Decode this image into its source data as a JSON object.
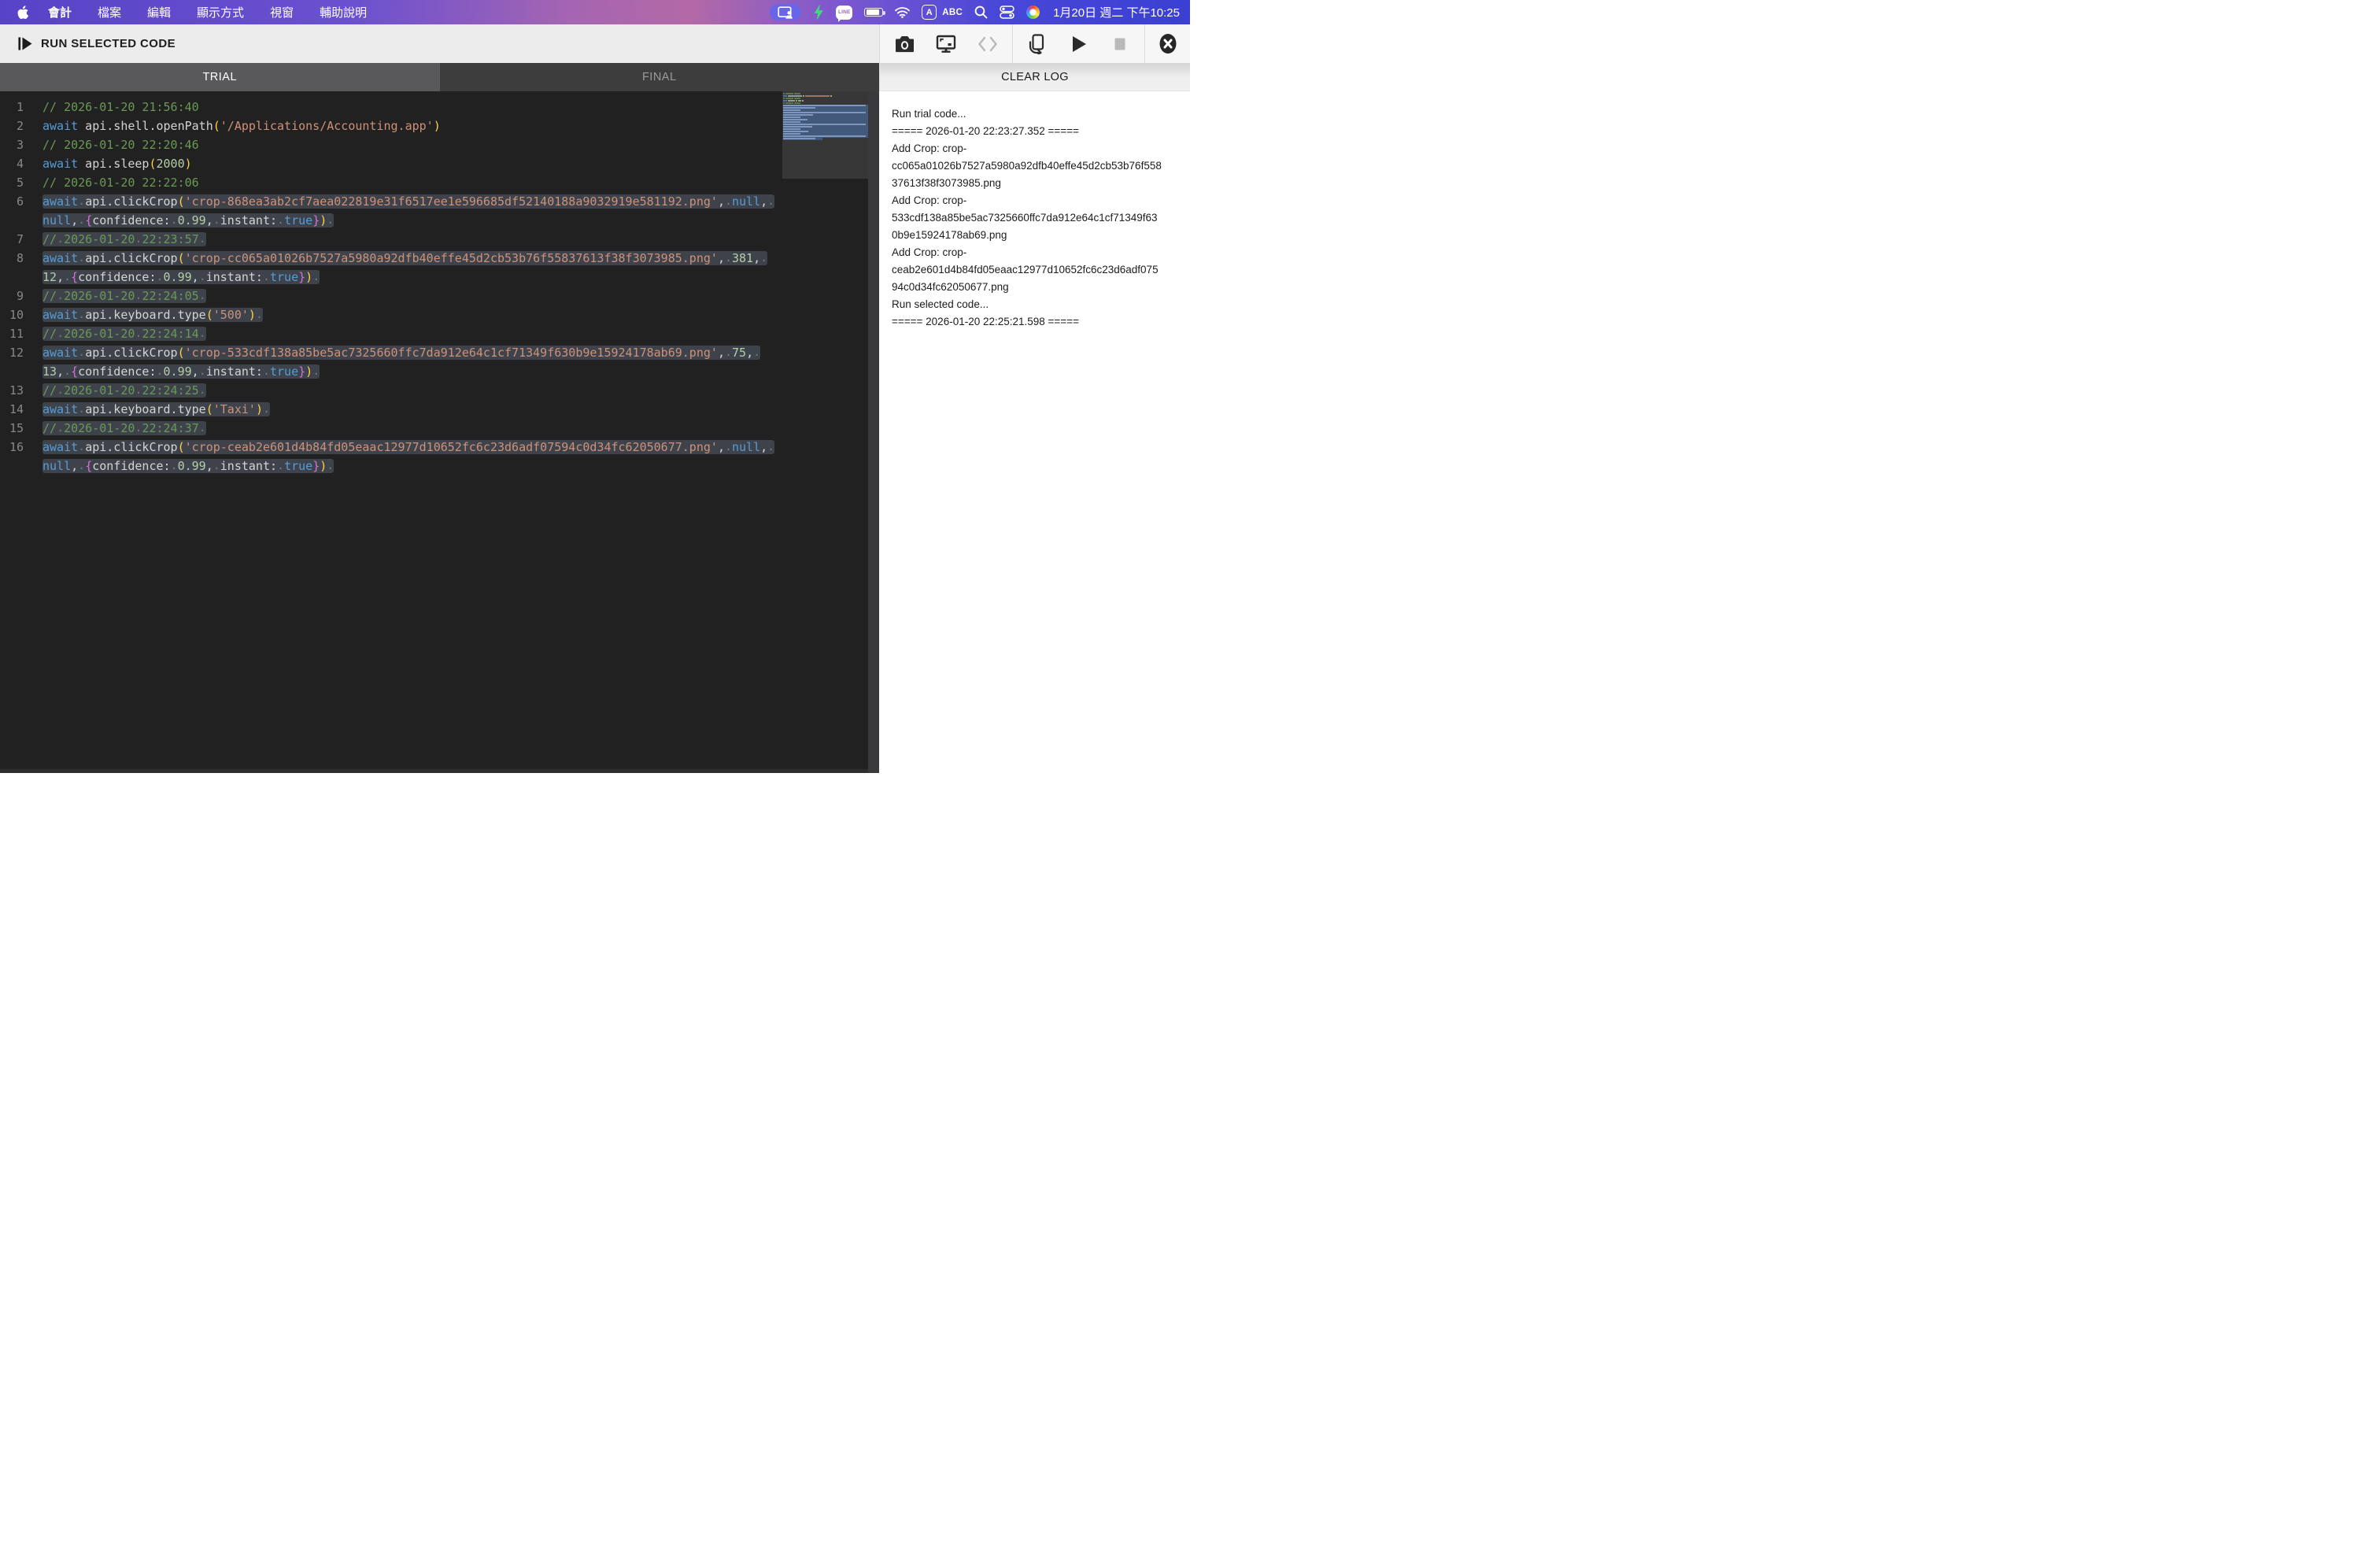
{
  "menu_bar": {
    "app_menus": [
      "會計",
      "檔案",
      "編輯",
      "顯示方式",
      "視窗",
      "輔助說明"
    ],
    "status": {
      "input_letter": "A",
      "input_abc": "ABC",
      "line_label": "LINE",
      "clock": "1月20日 週二 下午10:25"
    }
  },
  "toolbar": {
    "run_selected_label": "RUN SELECTED CODE"
  },
  "tabs": {
    "trial": "TRIAL",
    "final": "FINAL"
  },
  "log_panel": {
    "clear_label": "CLEAR LOG",
    "lines": [
      "Run trial code...",
      "===== 2026-01-20 22:23:27.352 =====",
      "Add Crop: crop-",
      "cc065a01026b7527a5980a92dfb40effe45d2cb53b76f558",
      "37613f38f3073985.png",
      "Add Crop: crop-",
      "533cdf138a85be5ac7325660ffc7da912e64c1cf71349f63",
      "0b9e15924178ab69.png",
      "Add Crop: crop-",
      "ceab2e601d4b84fd05eaac12977d10652fc6c23d6adf075",
      "94c0d34fc62050677.png",
      "Run selected code...",
      "===== 2026-01-20 22:25:21.598 ====="
    ]
  },
  "editor": {
    "lines": [
      {
        "n": 1,
        "selected": false,
        "tokens": [
          [
            "cm",
            "// 2026-01-20 21:56:40"
          ]
        ]
      },
      {
        "n": 2,
        "selected": false,
        "tokens": [
          [
            "kw",
            "await"
          ],
          [
            "id",
            " api.shell.openPath"
          ],
          [
            "p1",
            "("
          ],
          [
            "str",
            "'/Applications/Accounting.app'"
          ],
          [
            "p1",
            ")"
          ]
        ]
      },
      {
        "n": 3,
        "selected": false,
        "tokens": [
          [
            "cm",
            "// 2026-01-20 22:20:46"
          ]
        ]
      },
      {
        "n": 4,
        "selected": false,
        "tokens": [
          [
            "kw",
            "await"
          ],
          [
            "id",
            " api.sleep"
          ],
          [
            "p1",
            "("
          ],
          [
            "num",
            "2000"
          ],
          [
            "p1",
            ")"
          ]
        ]
      },
      {
        "n": 5,
        "selected": false,
        "tokens": [
          [
            "cm",
            "// 2026-01-20 22:22:06"
          ]
        ]
      },
      {
        "n": 6,
        "selected": true,
        "tokens": [
          [
            "kw",
            "await"
          ],
          [
            "id",
            " api.clickCrop"
          ],
          [
            "p1",
            "("
          ],
          [
            "str",
            "'crop-868ea3ab2cf7aea022819e31f6517ee1e596685df52140188a9032919e581192.png'"
          ],
          [
            "id",
            ", "
          ],
          [
            "kw",
            "null"
          ],
          [
            "id",
            ", "
          ],
          [
            "kw",
            "null"
          ],
          [
            "id",
            ", "
          ],
          [
            "p2",
            "{"
          ],
          [
            "id",
            "confidence: "
          ],
          [
            "num",
            "0.99"
          ],
          [
            "id",
            ", instant: "
          ],
          [
            "kw",
            "true"
          ],
          [
            "p2",
            "}"
          ],
          [
            "p1",
            ")"
          ]
        ]
      },
      {
        "n": 7,
        "selected": true,
        "tokens": [
          [
            "cm",
            "// 2026-01-20 22:23:57"
          ]
        ]
      },
      {
        "n": 8,
        "selected": true,
        "tokens": [
          [
            "kw",
            "await"
          ],
          [
            "id",
            " api.clickCrop"
          ],
          [
            "p1",
            "("
          ],
          [
            "str",
            "'crop-cc065a01026b7527a5980a92dfb40effe45d2cb53b76f55837613f38f3073985.png'"
          ],
          [
            "id",
            ", "
          ],
          [
            "num",
            "381"
          ],
          [
            "id",
            ", "
          ],
          [
            "num",
            "12"
          ],
          [
            "id",
            ", "
          ],
          [
            "p2",
            "{"
          ],
          [
            "id",
            "confidence: "
          ],
          [
            "num",
            "0.99"
          ],
          [
            "id",
            ", instant: "
          ],
          [
            "kw",
            "true"
          ],
          [
            "p2",
            "}"
          ],
          [
            "p1",
            ")"
          ]
        ]
      },
      {
        "n": 9,
        "selected": true,
        "tokens": [
          [
            "cm",
            "// 2026-01-20 22:24:05"
          ]
        ]
      },
      {
        "n": 10,
        "selected": true,
        "tokens": [
          [
            "kw",
            "await"
          ],
          [
            "id",
            " api.keyboard.type"
          ],
          [
            "p1",
            "("
          ],
          [
            "str",
            "'500'"
          ],
          [
            "p1",
            ")"
          ]
        ]
      },
      {
        "n": 11,
        "selected": true,
        "tokens": [
          [
            "cm",
            "// 2026-01-20 22:24:14"
          ]
        ]
      },
      {
        "n": 12,
        "selected": true,
        "tokens": [
          [
            "kw",
            "await"
          ],
          [
            "id",
            " api.clickCrop"
          ],
          [
            "p1",
            "("
          ],
          [
            "str",
            "'crop-533cdf138a85be5ac7325660ffc7da912e64c1cf71349f630b9e15924178ab69.png'"
          ],
          [
            "id",
            ", "
          ],
          [
            "num",
            "75"
          ],
          [
            "id",
            ", "
          ],
          [
            "num",
            "13"
          ],
          [
            "id",
            ", "
          ],
          [
            "p2",
            "{"
          ],
          [
            "id",
            "confidence: "
          ],
          [
            "num",
            "0.99"
          ],
          [
            "id",
            ", instant: "
          ],
          [
            "kw",
            "true"
          ],
          [
            "p2",
            "}"
          ],
          [
            "p1",
            ")"
          ]
        ]
      },
      {
        "n": 13,
        "selected": true,
        "tokens": [
          [
            "cm",
            "// 2026-01-20 22:24:25"
          ]
        ]
      },
      {
        "n": 14,
        "selected": true,
        "tokens": [
          [
            "kw",
            "await"
          ],
          [
            "id",
            " api.keyboard.type"
          ],
          [
            "p1",
            "("
          ],
          [
            "str",
            "'Taxi'"
          ],
          [
            "p1",
            ")"
          ]
        ]
      },
      {
        "n": 15,
        "selected": true,
        "tokens": [
          [
            "cm",
            "// 2026-01-20 22:24:37"
          ]
        ]
      },
      {
        "n": 16,
        "selected": true,
        "tokens": [
          [
            "kw",
            "await"
          ],
          [
            "id",
            " api.clickCrop"
          ],
          [
            "p1",
            "("
          ],
          [
            "str",
            "'crop-ceab2e601d4b84fd05eaac12977d10652fc6c23d6adf07594c0d34fc62050677.png'"
          ],
          [
            "id",
            ", "
          ],
          [
            "kw",
            "null"
          ],
          [
            "id",
            ", "
          ],
          [
            "kw",
            "null"
          ],
          [
            "id",
            ", "
          ],
          [
            "p2",
            "{"
          ],
          [
            "id",
            "confidence: "
          ],
          [
            "num",
            "0.99"
          ],
          [
            "id",
            ", instant: "
          ],
          [
            "kw",
            "true"
          ],
          [
            "p2",
            "}"
          ],
          [
            "p1",
            ")"
          ]
        ]
      }
    ]
  },
  "colors": {
    "menubar_left": "#5743c7",
    "menubar_pink": "#b469a6",
    "menubar_right": "#3a40d3",
    "mirror_chip_bg": "#6a64e8",
    "bolt_green": "#42d97d",
    "editor_bg": "#212121",
    "selection_bg": "#3e434b",
    "minimap_selection": "#42597c",
    "comment": "#6a9955",
    "keyword": "#569cd6",
    "string": "#ce9178",
    "number": "#b5cea8",
    "bracket_gold": "#ffd23f",
    "bracket_purple": "#d670d6"
  }
}
